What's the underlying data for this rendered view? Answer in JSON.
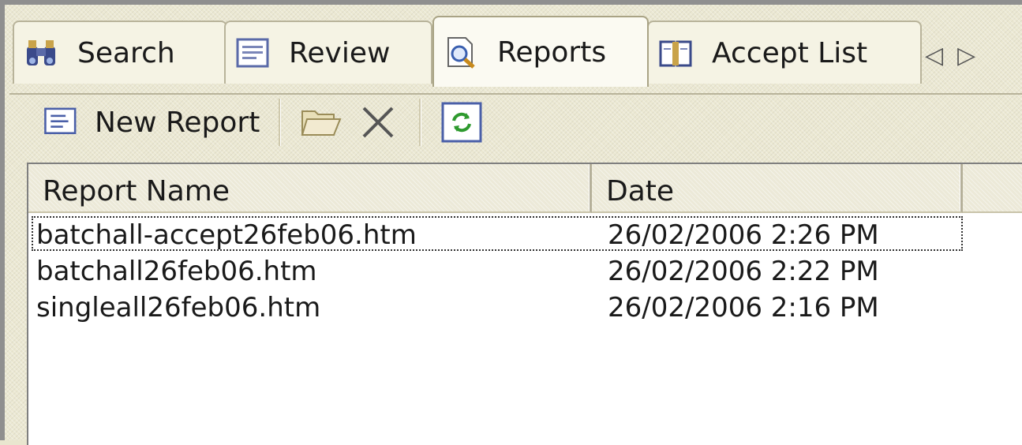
{
  "tabs": [
    {
      "label": "Search",
      "icon": "binoculars-icon"
    },
    {
      "label": "Review",
      "icon": "review-icon"
    },
    {
      "label": "Reports",
      "icon": "magnifier-document-icon",
      "active": true
    },
    {
      "label": "Accept List",
      "icon": "book-icon"
    }
  ],
  "tab_scroll": {
    "left": "◁",
    "right": "▷"
  },
  "toolbar": {
    "new_report_label": "New Report",
    "open_icon": "folder-open-icon",
    "delete_icon": "delete-x-icon",
    "refresh_icon": "refresh-icon"
  },
  "list": {
    "columns": [
      "Report Name",
      "Date"
    ],
    "rows": [
      {
        "name": "batchall-accept26feb06.htm",
        "date": "26/02/2006 2:26 PM",
        "focused": true
      },
      {
        "name": "batchall26feb06.htm",
        "date": "26/02/2006 2:22 PM"
      },
      {
        "name": "singleall26feb06.htm",
        "date": "26/02/2006 2:16 PM"
      }
    ]
  },
  "colors": {
    "accent": "#316ac5",
    "tab_border": "#b8b39a",
    "background": "#ebe8d2"
  }
}
